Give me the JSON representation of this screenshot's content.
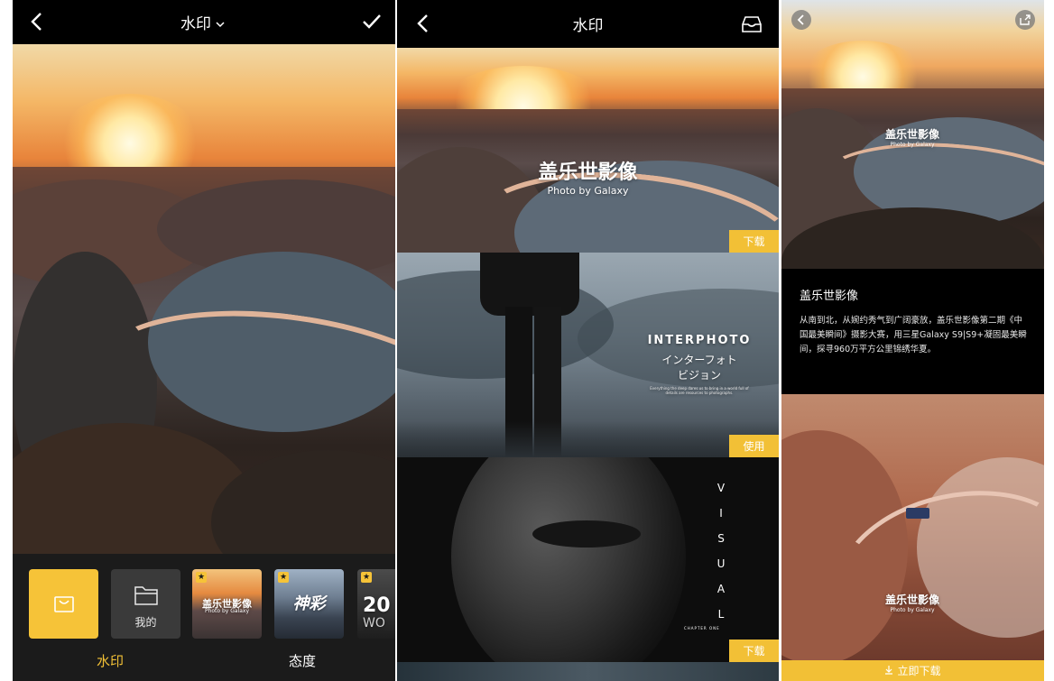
{
  "editor": {
    "title": "水印",
    "tabs": [
      {
        "label": "水印",
        "color": "#f2c036"
      },
      {
        "label": "态度",
        "color": "#ffffff"
      }
    ],
    "thumbnails": {
      "mine_label": "我的",
      "gai_title": "盖乐世影像",
      "gai_sub": "Photo by Galaxy",
      "attitude_text": "神彩",
      "cut_text_top": "20",
      "cut_text_bottom": "WO"
    }
  },
  "store": {
    "title": "水印",
    "cards": [
      {
        "wm_title": "盖乐世影像",
        "wm_sub": "Photo by Galaxy",
        "action": "下载"
      },
      {
        "wm_title": "INTERPHOTO",
        "wm_sub": "インターフォト\nビジョン",
        "wm_note": "Everything the deep dares us to bring in a world full of details are resources to photographs.",
        "action": "使用"
      },
      {
        "wm_letters": [
          "V",
          "I",
          "S",
          "U",
          "A",
          "L"
        ],
        "wm_chapter": "CHAPTER ONE",
        "action": "下载"
      }
    ]
  },
  "detail": {
    "top_wm_title": "盖乐世影像",
    "top_wm_sub": "Photo by Galaxy",
    "heading": "盖乐世影像",
    "description": "从南到北，从婉约秀气到广阔豪放，盖乐世影像第二期《中国最美瞬间》摄影大赛，用三星Galaxy S9|S9+凝固最美瞬间，探寻960万平方公里锦绣华夏。",
    "bottom_wm_title": "盖乐世影像",
    "bottom_wm_sub": "Photo by Galaxy",
    "download_label": "立即下载"
  },
  "colors": {
    "accent": "#f2c036",
    "dark": "#1b1b1b"
  }
}
